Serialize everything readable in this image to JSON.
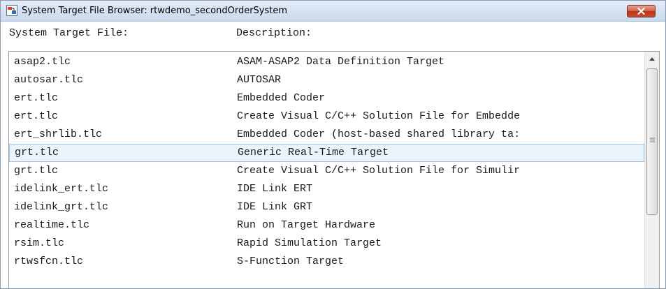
{
  "window": {
    "title": "System Target File Browser: rtwdemo_secondOrderSystem"
  },
  "header": {
    "col1": "System Target File:",
    "col2": "Description:"
  },
  "rows": [
    {
      "file": "asap2.tlc",
      "description": "ASAM-ASAP2 Data Definition Target"
    },
    {
      "file": "autosar.tlc",
      "description": "AUTOSAR"
    },
    {
      "file": "ert.tlc",
      "description": "Embedded Coder"
    },
    {
      "file": "ert.tlc",
      "description": "Create Visual C/C++ Solution File for Embedde"
    },
    {
      "file": "ert_shrlib.tlc",
      "description": "Embedded Coder (host-based shared library ta:"
    },
    {
      "file": "grt.tlc",
      "description": "Generic Real-Time Target"
    },
    {
      "file": "grt.tlc",
      "description": "Create Visual C/C++ Solution File for Simulir"
    },
    {
      "file": "idelink_ert.tlc",
      "description": "IDE Link ERT"
    },
    {
      "file": "idelink_grt.tlc",
      "description": "IDE Link GRT"
    },
    {
      "file": "realtime.tlc",
      "description": "Run on Target Hardware"
    },
    {
      "file": "rsim.tlc",
      "description": "Rapid Simulation Target"
    },
    {
      "file": "rtwsfcn.tlc",
      "description": "S-Function Target"
    }
  ],
  "selected_row_label": "grt.tlc — Generic Real-Time Target",
  "colors": {
    "selection_fill": "#ebf4fd",
    "selection_border": "#9dc3e7",
    "close_button": "#c84a2e"
  }
}
